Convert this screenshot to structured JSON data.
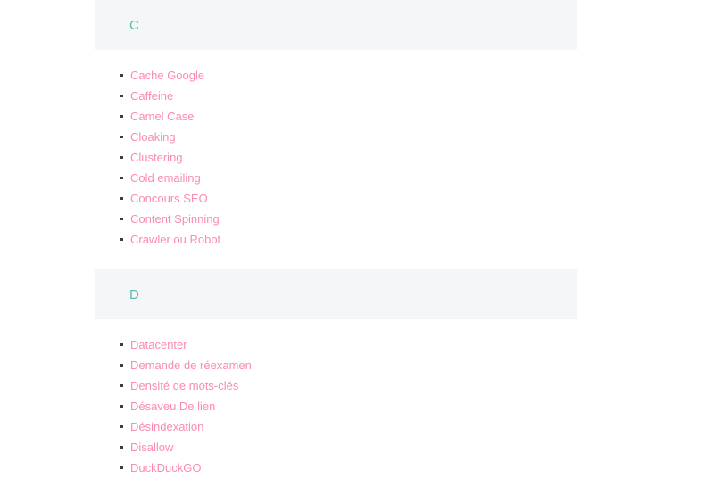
{
  "page": {
    "background_color": "#ffffff",
    "band_color": "#f5f6f8",
    "letter_color": "#57bdb2",
    "link_color": "#fa8caf",
    "bullet_color": "#3c3c3c"
  },
  "sections": [
    {
      "letter": "C",
      "terms": [
        "Cache Google",
        "Caffeine",
        "Camel Case",
        "Cloaking",
        "Clustering",
        "Cold emailing",
        "Concours SEO",
        "Content Spinning",
        "Crawler ou Robot"
      ]
    },
    {
      "letter": "D",
      "terms": [
        "Datacenter",
        "Demande de réexamen",
        "Densité de mots-clés",
        "Désaveu De lien",
        "Désindexation",
        "Disallow",
        "DuckDuckGO"
      ]
    }
  ]
}
